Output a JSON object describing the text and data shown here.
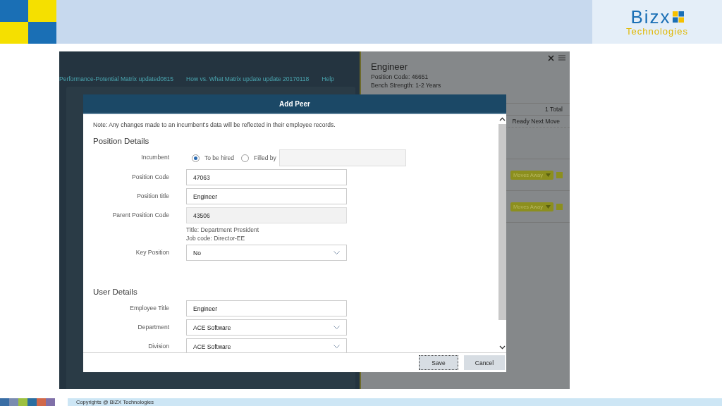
{
  "header": {
    "logo_word": "Bizx",
    "logo_sub": "Technologies"
  },
  "app": {
    "nav": [
      "Performance-Potential Matrix updated0815",
      "How vs. What Matrix update update 20170118",
      "Help"
    ],
    "side_panel": {
      "title": "Engineer",
      "lines": [
        "Position Code: 46651",
        "Bench Strength: 1-2 Years"
      ],
      "total": "1 Total",
      "column": "Ready Next Move",
      "pills": [
        "Moves Away",
        "Moves Away"
      ]
    }
  },
  "dialog": {
    "title": "Add Peer",
    "note": "Note: Any changes made to an incumbent's data will be reflected in their employee records.",
    "sections": [
      {
        "heading": "Position Details",
        "fields": [
          {
            "kind": "radio",
            "label": "Incumbent",
            "options": [
              {
                "label": "To be hired",
                "selected": true
              },
              {
                "label": "Filled by",
                "selected": false
              }
            ]
          },
          {
            "kind": "text",
            "label": "Position Code",
            "value": "47063",
            "disabled": false
          },
          {
            "kind": "text",
            "label": "Position title",
            "value": "Engineer",
            "disabled": false
          },
          {
            "kind": "text",
            "label": "Parent Position Code",
            "value": "43506",
            "disabled": true,
            "notes": [
              "Title: Department President",
              "Job code: Director-EE"
            ]
          },
          {
            "kind": "select",
            "label": "Key Position",
            "value": "No"
          }
        ]
      },
      {
        "heading": "User Details",
        "fields": [
          {
            "kind": "text",
            "label": "Employee Title",
            "value": "Engineer",
            "disabled": false
          },
          {
            "kind": "select",
            "label": "Department",
            "value": "ACE Software"
          },
          {
            "kind": "select",
            "label": "Division",
            "value": "ACE Software"
          }
        ]
      }
    ],
    "buttons": [
      {
        "label": "Save",
        "focused": true
      },
      {
        "label": "Cancel",
        "focused": false
      }
    ]
  },
  "footer": {
    "text": "Copyrights @ BIZX Technologies"
  }
}
